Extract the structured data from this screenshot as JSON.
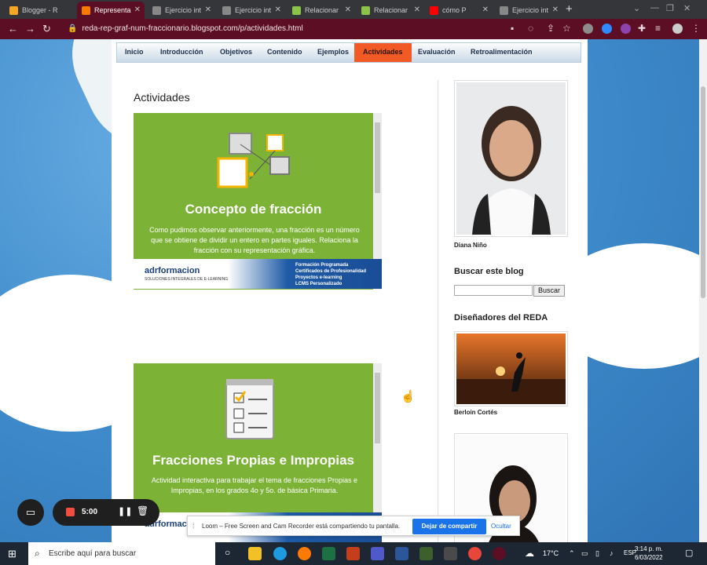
{
  "browser": {
    "tabs": [
      {
        "label": "Blogger - R",
        "color": "#f5a623",
        "active": false
      },
      {
        "label": "Representa",
        "color": "#f57c00",
        "active": true
      },
      {
        "label": "Ejercicio int",
        "color": "#888888",
        "active": false
      },
      {
        "label": "Ejercicio int",
        "color": "#888888",
        "active": false
      },
      {
        "label": "Relacionar",
        "color": "#8bc34a",
        "active": false
      },
      {
        "label": "Relacionar",
        "color": "#8bc34a",
        "active": false
      },
      {
        "label": "cómo P",
        "color": "#ff0000",
        "active": false
      },
      {
        "label": "Ejercicio int",
        "color": "#888888",
        "active": false
      }
    ],
    "url": "reda-rep-graf-num-fraccionario.blogspot.com/p/actividades.html"
  },
  "menu": {
    "items": [
      "Inicio",
      "Introducción",
      "Objetivos",
      "Contenido",
      "Ejemplos",
      "Actividades",
      "Evaluación",
      "Retroalimentación"
    ],
    "active": "Actividades"
  },
  "post": {
    "title": "Actividades",
    "cards": [
      {
        "heading": "Concepto de fracción",
        "text": "Como pudimos observar anteriormente, una fracción es un número que se obtiene de dividir un entero en partes iguales. Relaciona la fracción con su representación gráfica."
      },
      {
        "heading": "Fracciones Propias e Impropias",
        "text": "Actividad interactiva para trabajar el tema de fracciones Propias e Impropias, en los grados 4o y 5o. de básica Primaria."
      }
    ],
    "ad": {
      "logo": "adrformacion",
      "sub": "SOLUCIONES INTEGRALES DE E-LEARNING",
      "lines": [
        "Formación Programada",
        "Certificados de Profesionalidad",
        "Proyectos e-learning",
        "LCMS Personalizado"
      ]
    }
  },
  "sidebar": {
    "profile_name": "Diana Niño",
    "search_title": "Buscar este blog",
    "search_button": "Buscar",
    "designers_title": "Diseñadores del REDA",
    "designer_name": "Berloin Cortés"
  },
  "loom": {
    "timer": "5:00",
    "share_text": "Loom – Free Screen and Cam Recorder está compartiendo tu pantalla.",
    "stop_label": "Dejar de compartir",
    "hide_label": "Ocultar"
  },
  "taskbar": {
    "search_placeholder": "Escribe aquí para buscar",
    "temperature": "17°C",
    "language": "ESP",
    "time": "3:14 p. m.",
    "date": "6/03/2022"
  }
}
